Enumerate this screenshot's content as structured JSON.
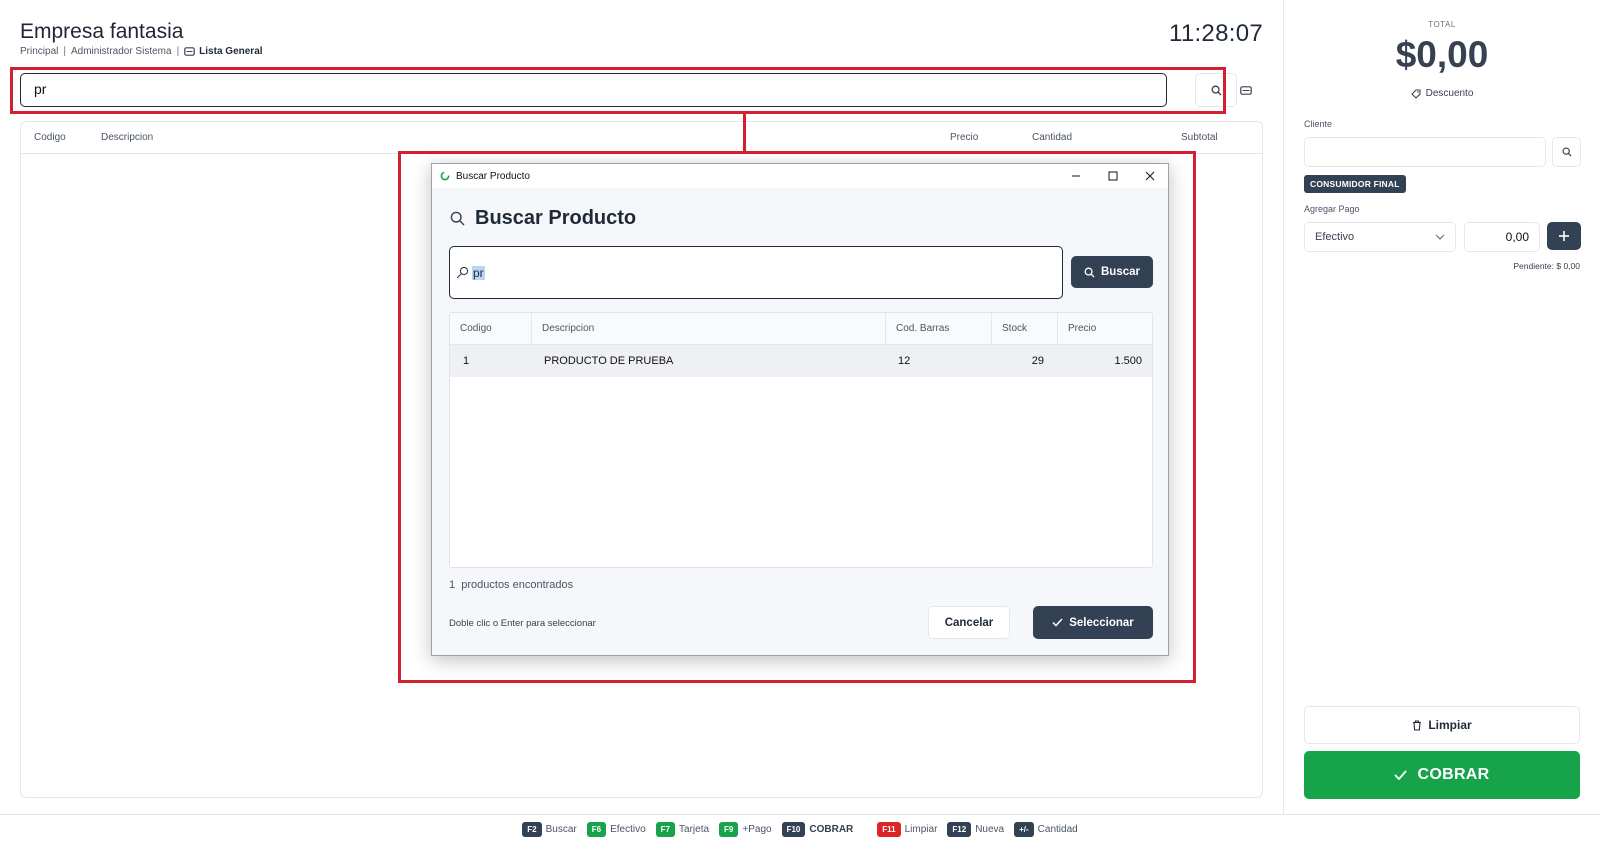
{
  "header": {
    "company": "Empresa fantasia",
    "branch": "Principal",
    "user": "Administrador Sistema",
    "price_list": "Lista General",
    "clock": "11:28:07"
  },
  "main_search": {
    "value": "pr"
  },
  "cart_table": {
    "columns": [
      "Codigo",
      "Descripcion",
      "Precio",
      "Cantidad",
      "Subtotal"
    ]
  },
  "right_panel": {
    "total_label": "TOTAL",
    "total_value": "$0,00",
    "discount_label": "Descuento",
    "client_label": "Cliente",
    "client_value": "",
    "client_badge": "CONSUMIDOR FINAL",
    "add_payment_label": "Agregar Pago",
    "payment_method": "Efectivo",
    "payment_amount": "0,00",
    "pending": "Pendiente: $ 0,00",
    "clear_label": "Limpiar",
    "charge_label": "COBRAR"
  },
  "shortcuts": [
    {
      "key": "F2",
      "label": "Buscar",
      "color": "#334155"
    },
    {
      "key": "F6",
      "label": "Efectivo",
      "color": "#16a34a"
    },
    {
      "key": "F7",
      "label": "Tarjeta",
      "color": "#16a34a"
    },
    {
      "key": "F9",
      "label": "+Pago",
      "color": "#16a34a"
    },
    {
      "key": "F10",
      "label": "COBRAR",
      "color": "#334155"
    },
    {
      "key": "F11",
      "label": "Limpiar",
      "color": "#dc2626"
    },
    {
      "key": "F12",
      "label": "Nueva",
      "color": "#334155"
    },
    {
      "key": "+/-",
      "label": "Cantidad",
      "color": "#334155"
    }
  ],
  "dialog": {
    "window_title": "Buscar Producto",
    "heading": "Buscar Producto",
    "search_value": "pr",
    "search_button": "Buscar",
    "columns": [
      "Codigo",
      "Descripcion",
      "Cod. Barras",
      "Stock",
      "Precio"
    ],
    "rows": [
      {
        "codigo": "1",
        "descripcion": "PRODUCTO DE PRUEBA",
        "cod_barras": "12",
        "stock": "29",
        "precio": "1.500"
      }
    ],
    "found_count": "1",
    "found_text": "productos encontrados",
    "hint": "Doble clic o Enter para seleccionar",
    "cancel_label": "Cancelar",
    "select_label": "Seleccionar"
  },
  "colors": {
    "highlight": "#d32030",
    "primary_dark": "#334155",
    "success": "#16a34a",
    "danger": "#dc2626"
  }
}
